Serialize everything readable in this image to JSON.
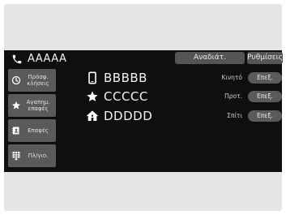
{
  "header": {
    "contact_name": "AAAAA",
    "redial_label": "Αναδιάτ.",
    "settings_label": "Ρυθμίσεις"
  },
  "sidebar": {
    "items": [
      {
        "label": "Πρόσφ. κλήσεις",
        "icon": "clock-icon"
      },
      {
        "label": "Αγαπημ. επαφές",
        "icon": "star-icon"
      },
      {
        "label": "Επαφές",
        "icon": "contacts-book-icon"
      },
      {
        "label": "Πλ/γιο.",
        "icon": "keypad-icon"
      }
    ]
  },
  "numbers": [
    {
      "name": "BBBBB",
      "type": "Κινητό",
      "icon": "mobile-phone-icon",
      "button": "Επεξ."
    },
    {
      "name": "CCCCC",
      "type": "Προτ.",
      "icon": "star-icon",
      "button": "Επεξ."
    },
    {
      "name": "DDDDD",
      "type": "Σπίτι",
      "icon": "home-icon",
      "button": "Επεξ."
    }
  ],
  "colors": {
    "screen_bg": "#0f0f0f",
    "button_gray": "#5a5a5a",
    "text": "#f2f2f2",
    "frame": "#e5e5e5"
  }
}
